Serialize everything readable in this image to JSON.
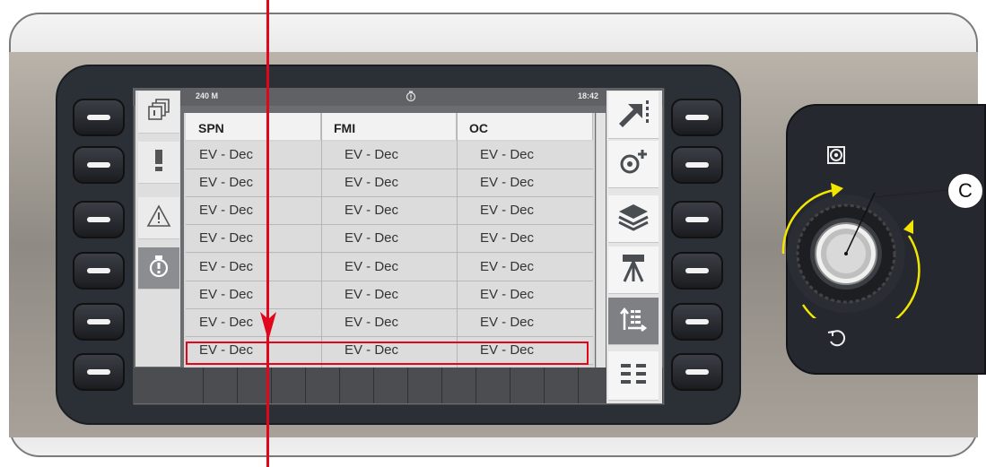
{
  "status_bar": {
    "left": "240 M",
    "right": "18:42",
    "center_icon": "diagnostic-icon"
  },
  "table": {
    "headers": [
      "SPN",
      "FMI",
      "OC"
    ],
    "rows": [
      [
        "EV - Dec",
        "EV - Dec",
        "EV - Dec"
      ],
      [
        "EV - Dec",
        "EV - Dec",
        "EV - Dec"
      ],
      [
        "EV - Dec",
        "EV - Dec",
        "EV - Dec"
      ],
      [
        "EV - Dec",
        "EV - Dec",
        "EV - Dec"
      ],
      [
        "EV - Dec",
        "EV - Dec",
        "EV - Dec"
      ],
      [
        "EV - Dec",
        "EV - Dec",
        "EV - Dec"
      ],
      [
        "EV - Dec",
        "EV - Dec",
        "EV - Dec"
      ],
      [
        "EV - Dec",
        "EV - Dec",
        "EV - Dec"
      ]
    ]
  },
  "left_tabs": [
    "windows-icon",
    "exclamation-icon",
    "warning-triangle-icon",
    "diagnostic-icon"
  ],
  "right_buttons": [
    "exit-arrow-icon",
    "add-settings-icon",
    "layers-icon",
    "tripod-icon",
    "sort-list-icon",
    "grid-menu-icon"
  ],
  "knob": {
    "top_icon": "home-target-icon",
    "bottom_icon": "back-icon"
  },
  "callout_label": "C",
  "colors": {
    "annotation_red": "#e1061c",
    "rotate_yellow": "#f2e600"
  }
}
